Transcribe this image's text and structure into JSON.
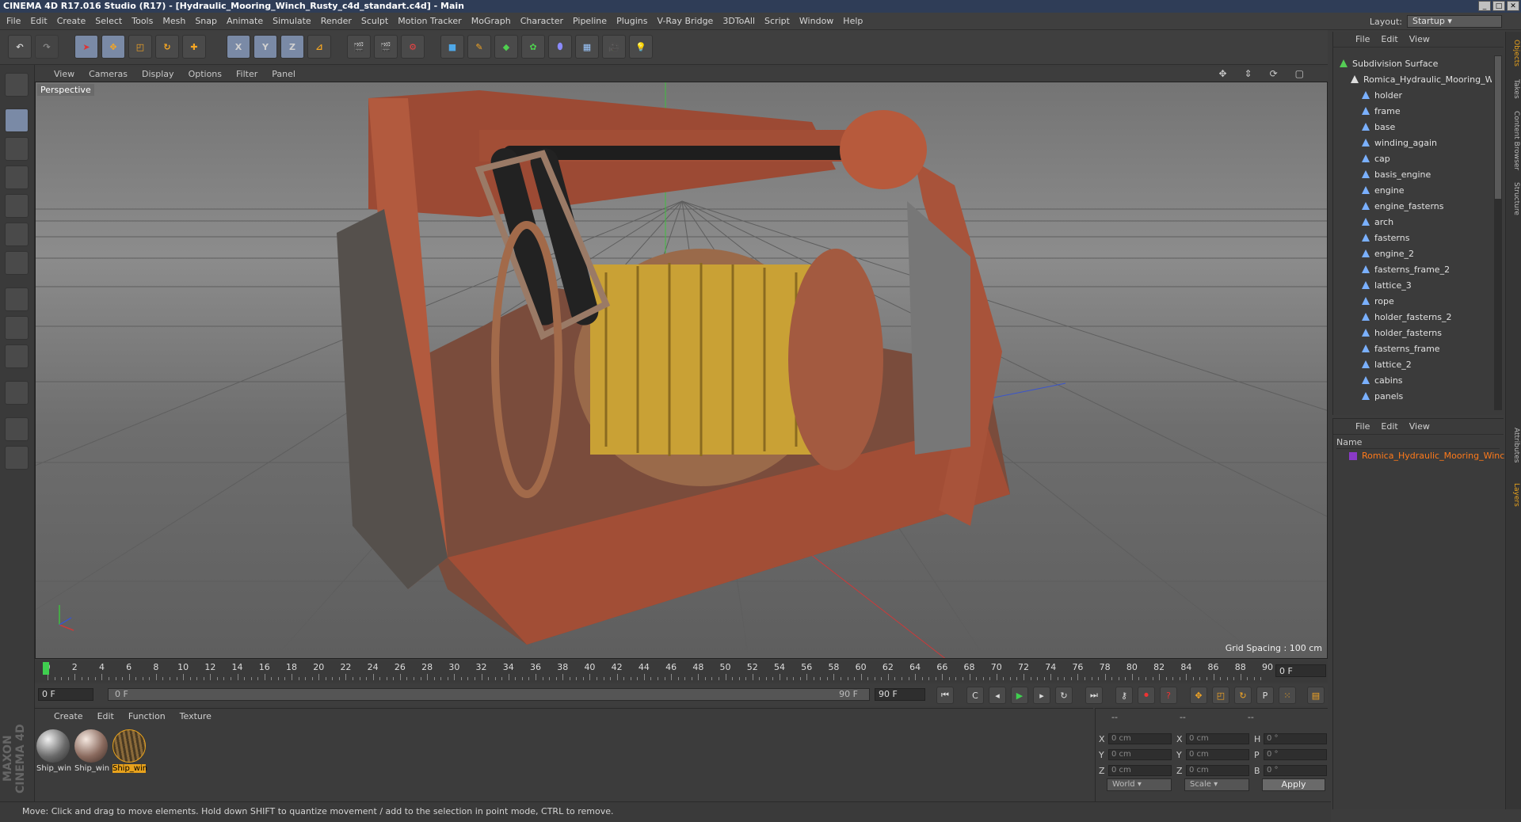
{
  "window": {
    "title": "CINEMA 4D R17.016 Studio (R17) - [Hydraulic_Mooring_Winch_Rusty_c4d_standart.c4d] - Main"
  },
  "menubar": {
    "items": [
      "File",
      "Edit",
      "Create",
      "Select",
      "Tools",
      "Mesh",
      "Snap",
      "Animate",
      "Simulate",
      "Render",
      "Sculpt",
      "Motion Tracker",
      "MoGraph",
      "Character",
      "Pipeline",
      "Plugins",
      "V-Ray Bridge",
      "3DToAll",
      "Script",
      "Window",
      "Help"
    ],
    "layout_label": "Layout:",
    "layout_value": "Startup"
  },
  "toolbar": {
    "axis_x": "X",
    "axis_y": "Y",
    "axis_z": "Z"
  },
  "viewport": {
    "menu": [
      "View",
      "Cameras",
      "Display",
      "Options",
      "Filter",
      "Panel"
    ],
    "camera_label": "Perspective",
    "grid_spacing": "Grid Spacing : 100 cm"
  },
  "timeline": {
    "ticks": [
      "0",
      "2",
      "4",
      "6",
      "8",
      "10",
      "12",
      "14",
      "16",
      "18",
      "20",
      "22",
      "24",
      "26",
      "28",
      "30",
      "32",
      "34",
      "36",
      "38",
      "40",
      "42",
      "44",
      "46",
      "48",
      "50",
      "52",
      "54",
      "56",
      "58",
      "60",
      "62",
      "64",
      "66",
      "68",
      "70",
      "72",
      "74",
      "76",
      "78",
      "80",
      "82",
      "84",
      "86",
      "88",
      "90"
    ],
    "current_frame": "0 F"
  },
  "transport": {
    "start_frame": "0 F",
    "range_start": "0 F",
    "range_end": "90 F",
    "end_frame": "90 F"
  },
  "materials": {
    "menu": [
      "Create",
      "Edit",
      "Function",
      "Texture"
    ],
    "items": [
      {
        "label": "Ship_win",
        "selected": false
      },
      {
        "label": "Ship_win",
        "selected": false
      },
      {
        "label": "Ship_win",
        "selected": true
      }
    ]
  },
  "coordinates": {
    "header_left": "--",
    "header_mid": "--",
    "header_right": "--",
    "rows": [
      {
        "a": "X",
        "av": "0 cm",
        "b": "X",
        "bv": "0 cm",
        "c": "H",
        "cv": "0 °"
      },
      {
        "a": "Y",
        "av": "0 cm",
        "b": "Y",
        "bv": "0 cm",
        "c": "P",
        "cv": "0 °"
      },
      {
        "a": "Z",
        "av": "0 cm",
        "b": "Z",
        "bv": "0 cm",
        "c": "B",
        "cv": "0 °"
      }
    ],
    "mode_world": "World",
    "mode_scale": "Scale",
    "apply": "Apply"
  },
  "status": {
    "text": "Move: Click and drag to move elements. Hold down SHIFT to quantize movement / add to the selection in point mode, CTRL to remove."
  },
  "objects_panel": {
    "menu": [
      "File",
      "Edit",
      "View"
    ],
    "items": [
      {
        "name": "Subdivision Surface",
        "level": 0,
        "color": "#55cc55"
      },
      {
        "name": "Romica_Hydraulic_Mooring_Winch",
        "level": 1,
        "color": "#dddddd"
      },
      {
        "name": "holder",
        "level": 2,
        "color": "#7ab0ff"
      },
      {
        "name": "frame",
        "level": 2,
        "color": "#7ab0ff"
      },
      {
        "name": "base",
        "level": 2,
        "color": "#7ab0ff"
      },
      {
        "name": "winding_again",
        "level": 2,
        "color": "#7ab0ff"
      },
      {
        "name": "cap",
        "level": 2,
        "color": "#7ab0ff"
      },
      {
        "name": "basis_engine",
        "level": 2,
        "color": "#7ab0ff"
      },
      {
        "name": "engine",
        "level": 2,
        "color": "#7ab0ff"
      },
      {
        "name": "engine_fasterns",
        "level": 2,
        "color": "#7ab0ff"
      },
      {
        "name": "arch",
        "level": 2,
        "color": "#7ab0ff"
      },
      {
        "name": "fasterns",
        "level": 2,
        "color": "#7ab0ff"
      },
      {
        "name": "engine_2",
        "level": 2,
        "color": "#7ab0ff"
      },
      {
        "name": "fasterns_frame_2",
        "level": 2,
        "color": "#7ab0ff"
      },
      {
        "name": "lattice_3",
        "level": 2,
        "color": "#7ab0ff"
      },
      {
        "name": "rope",
        "level": 2,
        "color": "#7ab0ff"
      },
      {
        "name": "holder_fasterns_2",
        "level": 2,
        "color": "#7ab0ff"
      },
      {
        "name": "holder_fasterns",
        "level": 2,
        "color": "#7ab0ff"
      },
      {
        "name": "fasterns_frame",
        "level": 2,
        "color": "#7ab0ff"
      },
      {
        "name": "lattice_2",
        "level": 2,
        "color": "#7ab0ff"
      },
      {
        "name": "cabins",
        "level": 2,
        "color": "#7ab0ff"
      },
      {
        "name": "panels",
        "level": 2,
        "color": "#7ab0ff"
      }
    ]
  },
  "layers_panel": {
    "menu": [
      "File",
      "Edit",
      "View"
    ],
    "header": "Name",
    "item": "Romica_Hydraulic_Mooring_Winch"
  },
  "side_tabs": [
    "Objects",
    "Takes",
    "Content Browser",
    "Structure",
    "Attributes",
    "Layers"
  ]
}
